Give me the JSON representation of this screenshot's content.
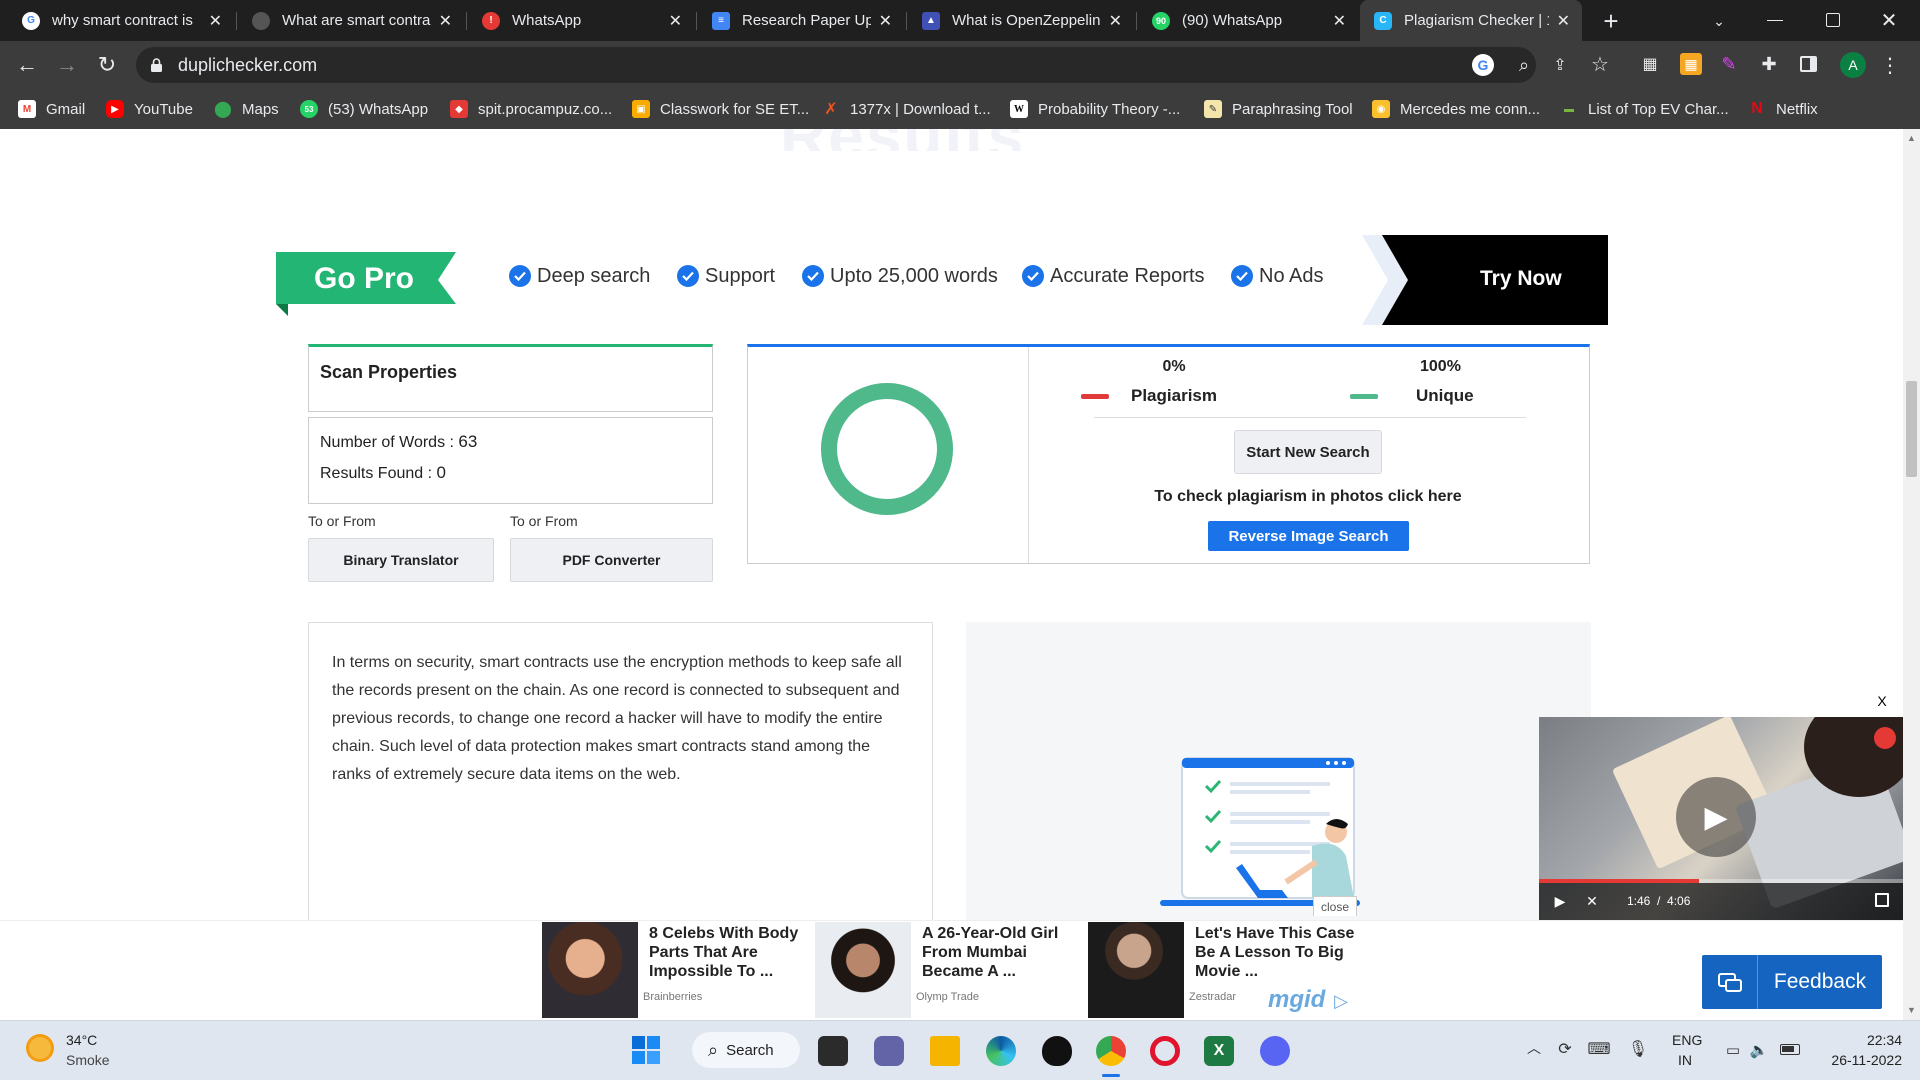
{
  "browser": {
    "tabs": [
      {
        "title": "why smart contract is",
        "active": false
      },
      {
        "title": "What are smart contra",
        "active": false
      },
      {
        "title": "WhatsApp",
        "active": false
      },
      {
        "title": "Research Paper Updat",
        "active": false
      },
      {
        "title": "What is OpenZeppelin",
        "active": false
      },
      {
        "title": "(90) WhatsApp",
        "active": false
      },
      {
        "title": "Plagiarism Checker | 1",
        "active": true
      }
    ],
    "url": "duplichecker.com",
    "profile_initial": "A",
    "bookmarks": [
      "Gmail",
      "YouTube",
      "Maps",
      "(53) WhatsApp",
      "spit.procampuz.co...",
      "Classwork for SE ET...",
      "1377x | Download t...",
      "Probability Theory -...",
      "Paraphrasing Tool",
      "Mercedes me conn...",
      "List of Top EV Char...",
      "Netflix"
    ]
  },
  "promo": {
    "go_pro": "Go Pro",
    "features": [
      "Deep search",
      "Support",
      "Upto 25,000 words",
      "Accurate Reports",
      "No Ads"
    ],
    "try_now": "Try Now"
  },
  "scan": {
    "title": "Scan Properties",
    "words_label": "Number of Words :",
    "words_value": "63",
    "results_label": "Results Found :",
    "results_value": "0",
    "to_or_from_1": "To or From",
    "to_or_from_2": "To or From",
    "binary_btn": "Binary Translator",
    "pdf_btn": "PDF Converter"
  },
  "results": {
    "plag_pct": "0%",
    "plag_label": "Plagiarism",
    "unique_pct": "100%",
    "unique_label": "Unique",
    "unique_fraction": 1.0,
    "start_new": "Start New Search",
    "photos_text": "To check plagiarism in photos click here",
    "reverse_btn": "Reverse Image Search"
  },
  "content": {
    "text": "In terms on security, smart contracts use the encryption methods to keep safe all the records present on the chain. As one record is connected to subsequent and previous records, to change one record a hacker will have to modify the entire chain. Such level of data protection makes smart contracts stand among the ranks of extremely secure data items on the web."
  },
  "video": {
    "close": "X",
    "time": "1:46  /  4:06",
    "progress": 0.44
  },
  "ads": {
    "close": "close",
    "items": [
      {
        "title": "8 Celebs With Body Parts That Are Impossible To ...",
        "source": "Brainberries"
      },
      {
        "title": "A 26-Year-Old Girl From Mumbai Became A ...",
        "source": "Olymp Trade"
      },
      {
        "title": "Let's Have This Case Be A Lesson To Big Movie ...",
        "source": "Zestradar"
      }
    ],
    "brand": "mgid"
  },
  "feedback": "Feedback",
  "taskbar": {
    "weather_temp": "34°C",
    "weather_desc": "Smoke",
    "search": "Search",
    "lang1": "ENG",
    "lang2": "IN",
    "time": "22:34",
    "date": "26-11-2022"
  },
  "colors": {
    "green": "#4fb98c",
    "red": "#e03a3a",
    "blue": "#1a73e8",
    "feedback_blue": "#1565c0"
  }
}
